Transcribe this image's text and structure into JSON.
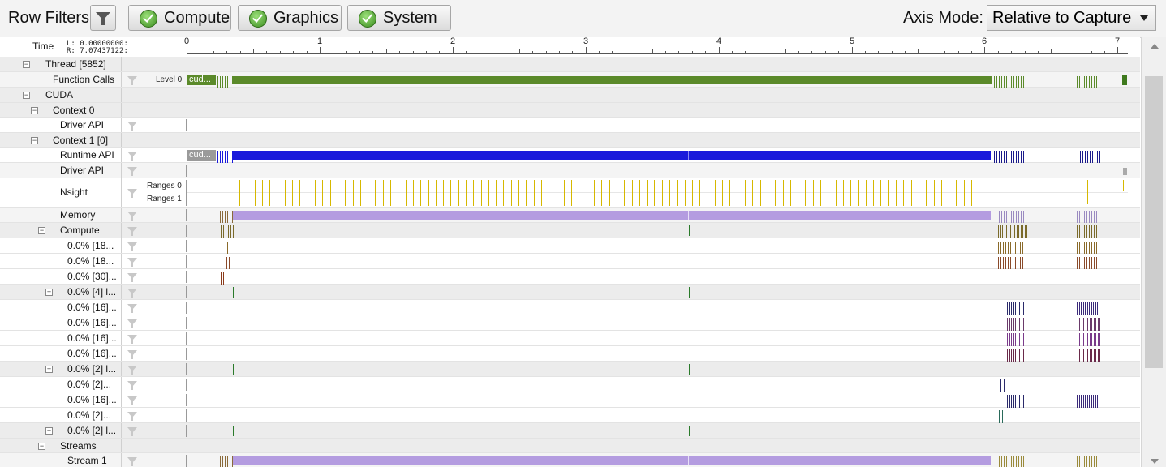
{
  "toolbar": {
    "row_filters_label": "Row Filters",
    "filter_icon": "funnel-icon",
    "buttons": [
      {
        "label": "Compute",
        "checked": true
      },
      {
        "label": "Graphics",
        "checked": true
      },
      {
        "label": "System",
        "checked": true
      }
    ],
    "axis_mode_label": "Axis Mode:",
    "axis_mode_value": "Relative to Capture"
  },
  "ruler": {
    "time_label": "Time",
    "left_value": "L: 0.00000000:",
    "right_value": "R: 7.07437122:",
    "ticks": [
      "0",
      "1",
      "2",
      "3",
      "4",
      "5",
      "6",
      "7"
    ]
  },
  "rows": [
    {
      "name": "Thread [5852]"
    },
    {
      "name": "Function Calls",
      "sublabel": "Level 0",
      "bar_label": "cud..."
    },
    {
      "name": "CUDA"
    },
    {
      "name": "Context 0"
    },
    {
      "name": "Driver API"
    },
    {
      "name": "Context 1 [0]"
    },
    {
      "name": "Runtime API",
      "bar_label": "cud..."
    },
    {
      "name": "Driver API"
    },
    {
      "name": "Nsight",
      "sublabels": [
        "Ranges 0",
        "Ranges 1"
      ]
    },
    {
      "name": "Memory"
    },
    {
      "name": "Compute"
    },
    {
      "name": "0.0% [18..."
    },
    {
      "name": "0.0% [18..."
    },
    {
      "name": "0.0% [30]..."
    },
    {
      "name": "0.0% [4] l..."
    },
    {
      "name": "0.0% [16]..."
    },
    {
      "name": "0.0% [16]..."
    },
    {
      "name": "0.0% [16]..."
    },
    {
      "name": "0.0% [16]..."
    },
    {
      "name": "0.0% [2] l..."
    },
    {
      "name": "0.0% [2]..."
    },
    {
      "name": "0.0% [16]..."
    },
    {
      "name": "0.0% [2]..."
    },
    {
      "name": "0.0% [2] l..."
    },
    {
      "name": "Streams"
    },
    {
      "name": "Stream 1"
    }
  ],
  "colors": {
    "function_calls": "#5b8a2a",
    "runtime_api": "#1a1adb",
    "memory": "#b49ce0",
    "nsight_range": "#e8c400",
    "compute_mark": "#7a6a2a",
    "kernel_dark": "#2a2a6a",
    "kernel_purple": "#7a3a8a",
    "marker_green": "#2a7a2a"
  }
}
